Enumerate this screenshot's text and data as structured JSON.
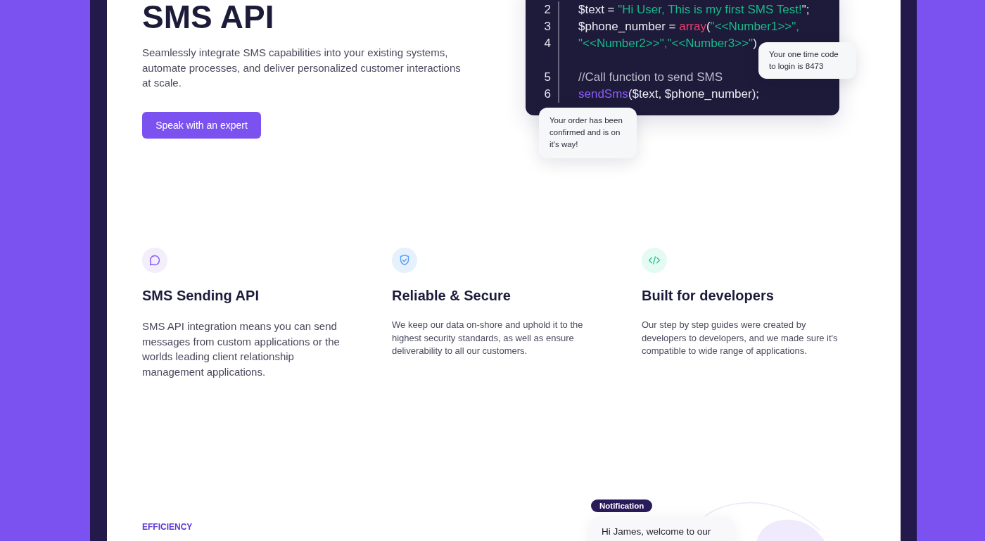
{
  "hero": {
    "title": "SMS API",
    "description": "Seamlessly integrate SMS capabilities into your existing systems, automate processes, and deliver personalized customer interactions at scale.",
    "button": "Speak with an expert"
  },
  "code": {
    "lines": [
      {
        "number": "2",
        "kind": "normal",
        "segments": [
          {
            "kind": "plain",
            "text": "$text = "
          },
          {
            "kind": "string",
            "text": "\"Hi User, This is my first SMS Test!"
          },
          {
            "kind": "plain",
            "text": "\";"
          }
        ]
      },
      {
        "number": "3",
        "kind": "normal",
        "segments": [
          {
            "kind": "plain",
            "text": "$phone_number = "
          },
          {
            "kind": "keyword",
            "text": "array"
          },
          {
            "kind": "plain",
            "text": "("
          },
          {
            "kind": "string",
            "text": "\"<<Number1>>\","
          }
        ]
      },
      {
        "number": "4",
        "kind": "normal",
        "segments": [
          {
            "kind": "string",
            "text": "\"<<Number2>>\",\"<<Number3>>\""
          },
          {
            "kind": "plain",
            "text": ")"
          }
        ]
      },
      {
        "number": "5",
        "kind": "after_gap",
        "segments": [
          {
            "kind": "comment",
            "text": "//Call function to send SMS"
          }
        ]
      },
      {
        "number": "6",
        "kind": "normal",
        "segments": [
          {
            "kind": "function",
            "text": "sendSms"
          },
          {
            "kind": "plain",
            "text": "($text, $phone_number);"
          }
        ]
      }
    ],
    "bubbles": [
      {
        "kind": "right",
        "text": "Your one time code to login is 8473"
      },
      {
        "kind": "left",
        "text": "Your order has been confirmed and is on it's way!"
      }
    ]
  },
  "features": [
    {
      "kind": "lead",
      "title": "SMS Sending API",
      "description": "SMS API integration means you can send messages from custom applications or the worlds leading client relationship management applications."
    },
    {
      "kind": "plain",
      "title": "Reliable & Secure",
      "description": "We keep our data on-shore and uphold it to the highest security standards, as well as ensure deliverability to all our customers."
    },
    {
      "kind": "plain",
      "title": "Built for developers",
      "description": "Our step by step guides were created by developers to developers, and we made sure it's compatible to wide range of applications."
    }
  ],
  "efficiency": {
    "eyebrow": "EFFICIENCY",
    "badge": "Notification",
    "message": "Hi James, welcome to our"
  }
}
